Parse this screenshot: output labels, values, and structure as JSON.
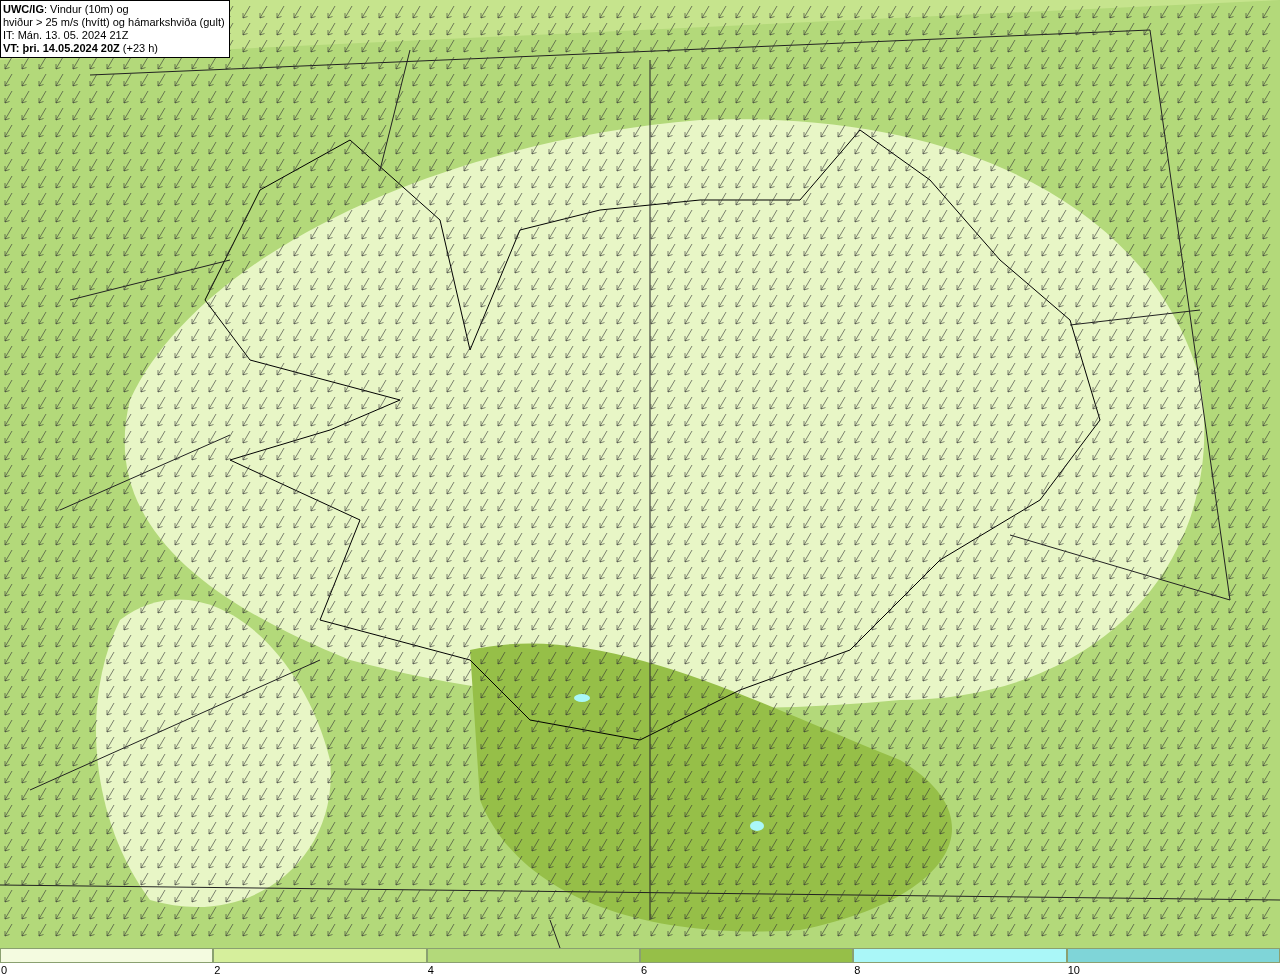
{
  "info_box": {
    "lines": [
      "**UWC/IG**: Vindur (10m) og",
      "hviður > 25 m/s (hvítt) og hámarkshviða (gult)",
      "IT: Mán. 13. 05. 2024 21Z",
      "**VT: þri. 14.05.2024 20Z** (+23 h)"
    ]
  },
  "color_scale": [
    {
      "label": "0",
      "color": "#f4fbe0"
    },
    {
      "label": "2",
      "color": "#d6ef9c"
    },
    {
      "label": "4",
      "color": "#b3d97a"
    },
    {
      "label": "6",
      "color": "#96bf48"
    },
    {
      "label": "8",
      "color": "#aaf7f8"
    },
    {
      "label": "10",
      "color": "#7fd5d8"
    }
  ]
}
